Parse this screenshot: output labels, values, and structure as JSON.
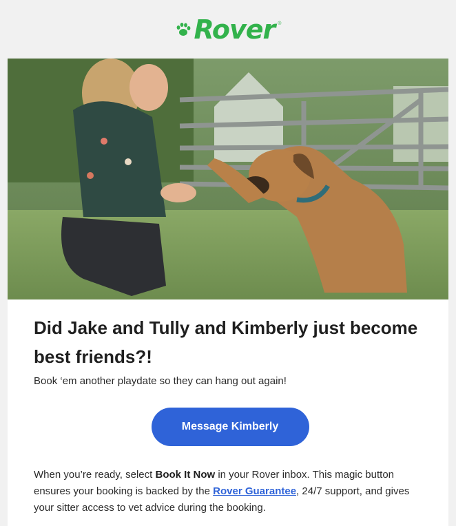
{
  "brand": {
    "name": "Rover",
    "mark": "®",
    "color": "#32b24b"
  },
  "hero": {
    "icon": "dog-handshake-photo"
  },
  "headline": "Did Jake and Tully and Kimberly just become best friends?!",
  "subhead": "Book ‘em another playdate so they can hang out again!",
  "cta": {
    "label": "Message Kimberly",
    "color": "#2f63d8"
  },
  "body": {
    "part1": "When you’re ready, select ",
    "bold": "Book It Now",
    "part2": " in your Rover inbox. This magic button ensures your booking is backed by the ",
    "link": "Rover Guarantee",
    "part3": ", 24/7 support, and gives your sitter access to vet advice during the booking."
  }
}
